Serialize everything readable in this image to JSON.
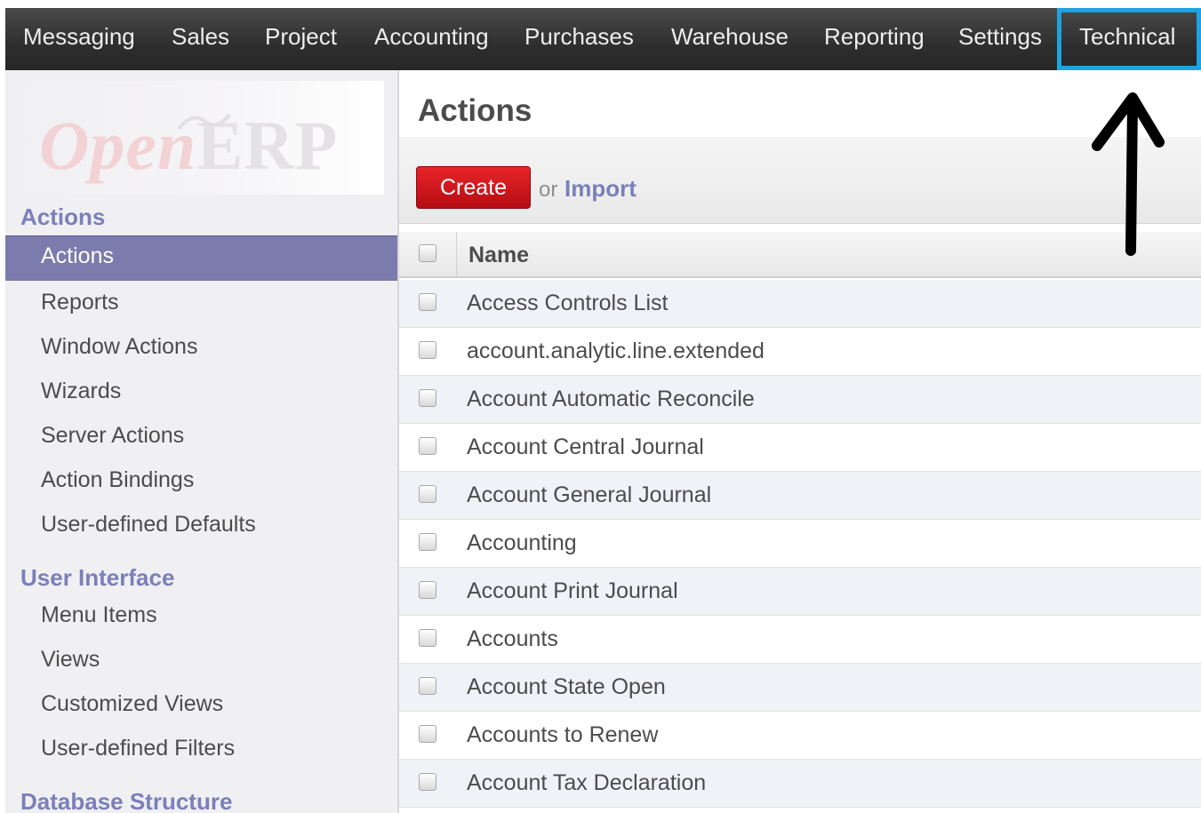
{
  "topbar": {
    "items": [
      "Messaging",
      "Sales",
      "Project",
      "Accounting",
      "Purchases",
      "Warehouse",
      "Reporting",
      "Settings",
      "Technical"
    ],
    "highlight_color": "#1ea3e0"
  },
  "logo": {
    "open": "Open",
    "erp": "ERP"
  },
  "sidebar": {
    "sections": [
      {
        "title": "Actions",
        "items": [
          "Actions",
          "Reports",
          "Window Actions",
          "Wizards",
          "Server Actions",
          "Action Bindings",
          "User-defined Defaults"
        ]
      },
      {
        "title": "User Interface",
        "items": [
          "Menu Items",
          "Views",
          "Customized Views",
          "User-defined Filters"
        ]
      },
      {
        "title": "Database Structure",
        "items": []
      }
    ],
    "active_item": "Actions",
    "active_color": "#7c7bad"
  },
  "main": {
    "title": "Actions",
    "create_label": "Create",
    "or_label": "or",
    "import_label": "Import",
    "column_name": "Name",
    "rows": [
      "Access Controls List",
      "account.analytic.line.extended",
      "Account Automatic Reconcile",
      "Account Central Journal",
      "Account General Journal",
      "Accounting",
      "Account Print Journal",
      "Accounts",
      "Account State Open",
      "Accounts to Renew",
      "Account Tax Declaration"
    ]
  },
  "annotation": {
    "icon": "arrow-up-icon"
  }
}
